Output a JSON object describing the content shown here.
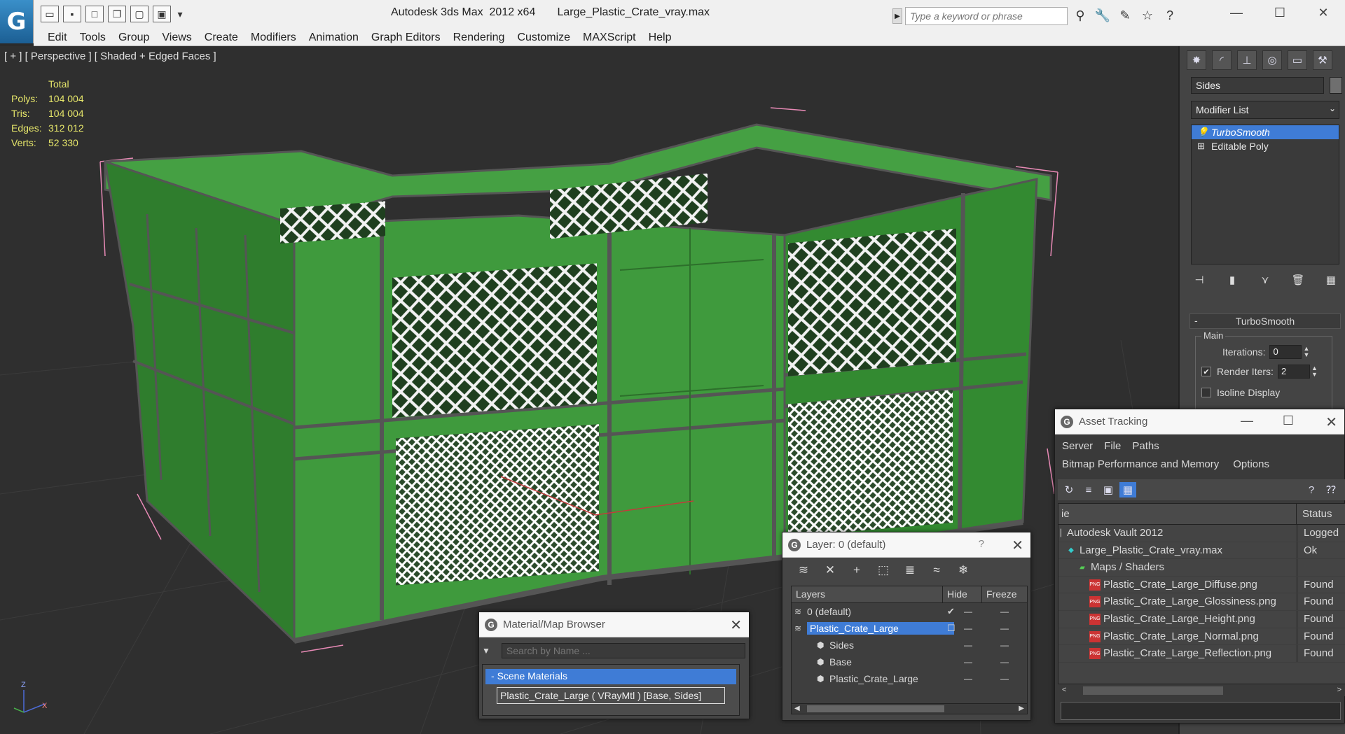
{
  "titlebar": {
    "app_logo": "G",
    "title": "Autodesk 3ds Max  2012 x64       Large_Plastic_Crate_vray.max",
    "search_placeholder": "Type a keyword or phrase",
    "quick_tools": [
      "open-icon",
      "save-icon",
      "new-icon",
      "copy-icon",
      "undo-icon",
      "redo-icon",
      "dropdown-icon"
    ],
    "win_controls": {
      "minimize": "—",
      "maximize": "☐",
      "close": "✕"
    }
  },
  "menu": [
    "Edit",
    "Tools",
    "Group",
    "Views",
    "Create",
    "Modifiers",
    "Animation",
    "Graph Editors",
    "Rendering",
    "Customize",
    "MAXScript",
    "Help"
  ],
  "viewport": {
    "label": "[ + ] [ Perspective ] [ Shaded + Edged Faces ]",
    "stats_head": "Total",
    "stats": [
      {
        "k": "Polys:",
        "v": "104 004"
      },
      {
        "k": "Tris:",
        "v": "104 004"
      },
      {
        "k": "Edges:",
        "v": "312 012"
      },
      {
        "k": "Verts:",
        "v": "52 330"
      }
    ],
    "axis": {
      "z": "Z",
      "x": "X"
    }
  },
  "command_panel": {
    "object_name": "Sides",
    "modifier_list": "Modifier List",
    "stack": [
      {
        "label": "TurboSmooth",
        "selected": true
      },
      {
        "label": "Editable Poly",
        "selected": false
      }
    ],
    "turbosmooth": {
      "title": "TurboSmooth",
      "group": "Main",
      "iterations_label": "Iterations:",
      "iterations": "0",
      "render_iters_label": "Render Iters:",
      "render_iters": "2",
      "isoline_label": "Isoline Display"
    }
  },
  "material_browser": {
    "title": "Material/Map Browser",
    "search_placeholder": "Search by Name ...",
    "category": "Scene Materials",
    "entry": "Plastic_Crate_Large  ( VRayMtl )  [Base, Sides]"
  },
  "layer_dialog": {
    "title": "Layer: 0 (default)",
    "help": "?",
    "columns": {
      "layers": "Layers",
      "hide": "Hide",
      "freeze": "Freeze"
    },
    "rows": [
      {
        "name": "0 (default)",
        "indent": 22,
        "selected": false,
        "marker": "✔"
      },
      {
        "name": "Plastic_Crate_Large",
        "indent": 22,
        "selected": true,
        "marker": "☐"
      },
      {
        "name": "Sides",
        "indent": 54,
        "selected": false,
        "marker": ""
      },
      {
        "name": "Base",
        "indent": 54,
        "selected": false,
        "marker": ""
      },
      {
        "name": "Plastic_Crate_Large",
        "indent": 54,
        "selected": false,
        "marker": ""
      }
    ]
  },
  "asset_tracking": {
    "title": "Asset Tracking",
    "menu1": [
      "Server",
      "File",
      "Paths"
    ],
    "menu2": [
      "Bitmap Performance and Memory",
      "Options"
    ],
    "col_name": "ie",
    "col_status": "Status",
    "rows": [
      {
        "name": "Autodesk Vault 2012",
        "status": "Logged",
        "indent": 12
      },
      {
        "name": "Large_Plastic_Crate_vray.max",
        "status": "Ok",
        "indent": 30
      },
      {
        "name": "Maps / Shaders",
        "status": "",
        "indent": 46
      },
      {
        "name": "Plastic_Crate_Large_Diffuse.png",
        "status": "Found",
        "indent": 64
      },
      {
        "name": "Plastic_Crate_Large_Glossiness.png",
        "status": "Found",
        "indent": 64
      },
      {
        "name": "Plastic_Crate_Large_Height.png",
        "status": "Found",
        "indent": 64
      },
      {
        "name": "Plastic_Crate_Large_Normal.png",
        "status": "Found",
        "indent": 64
      },
      {
        "name": "Plastic_Crate_Large_Reflection.png",
        "status": "Found",
        "indent": 64
      }
    ]
  },
  "colors": {
    "crate_green": "#3f9a3d",
    "selection_blue": "#3f7cd6",
    "stats_yellow": "#e6e66a"
  }
}
